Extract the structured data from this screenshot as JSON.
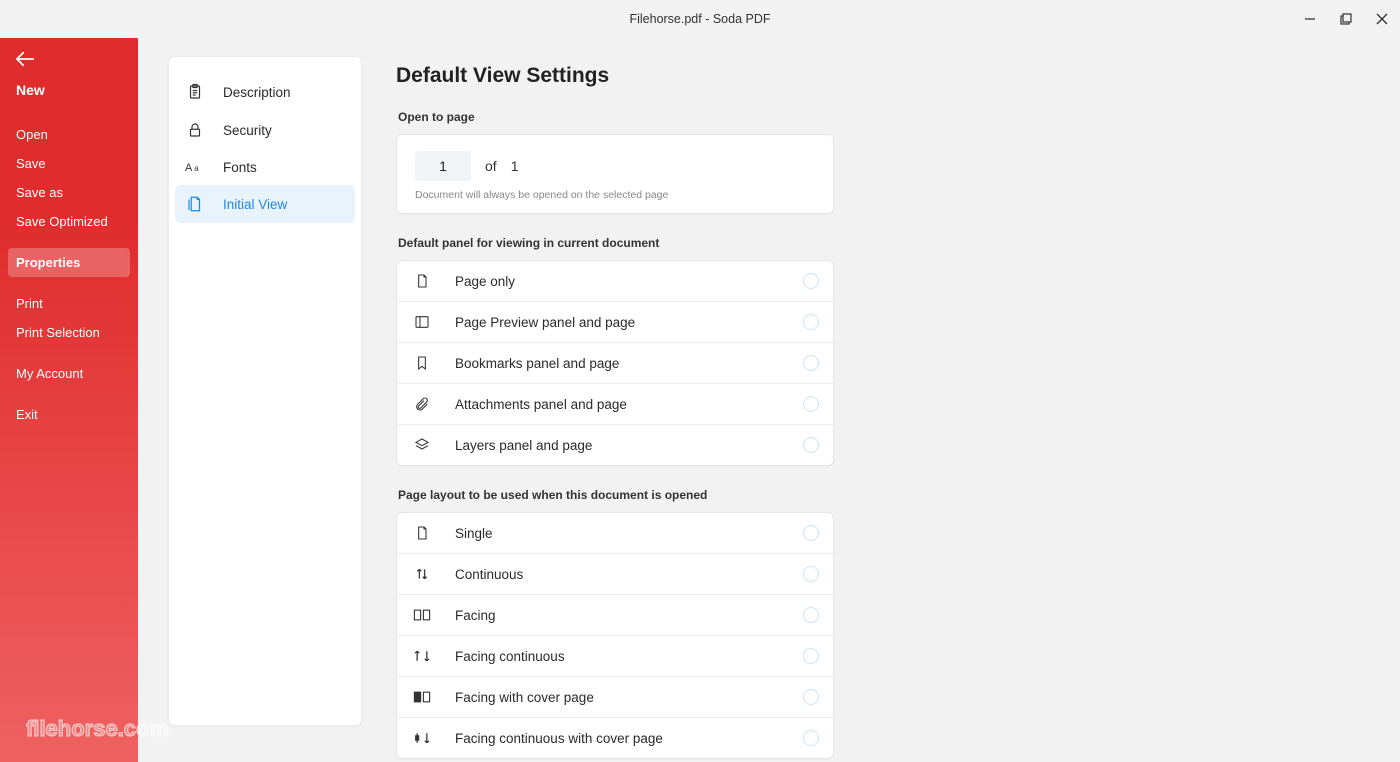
{
  "title": "Filehorse.pdf   -   Soda PDF",
  "leftMenu": {
    "new": "New",
    "open": "Open",
    "save": "Save",
    "saveAs": "Save as",
    "saveOptimized": "Save Optimized",
    "properties": "Properties",
    "print": "Print",
    "printSelection": "Print Selection",
    "myAccount": "My Account",
    "exit": "Exit"
  },
  "settingsNav": {
    "description": "Description",
    "security": "Security",
    "fonts": "Fonts",
    "initialView": "Initial View"
  },
  "main": {
    "heading": "Default View Settings",
    "openToPageLabel": "Open to page",
    "openPage": {
      "value": "1",
      "of": "of",
      "total": "1",
      "hint": "Document will always be opened on the selected page"
    },
    "panelLabel": "Default panel for viewing in current document",
    "panels": {
      "pageOnly": "Page only",
      "preview": "Page Preview panel and page",
      "bookmarks": "Bookmarks panel and page",
      "attachments": "Attachments panel and page",
      "layers": "Layers panel and page"
    },
    "layoutLabel": "Page layout to be used when this document is opened",
    "layouts": {
      "single": "Single",
      "continuous": "Continuous",
      "facing": "Facing",
      "facingContinuous": "Facing continuous",
      "facingCover": "Facing with cover page",
      "facingContCover": "Facing continuous with cover page"
    }
  },
  "watermark": "filehorse.com"
}
